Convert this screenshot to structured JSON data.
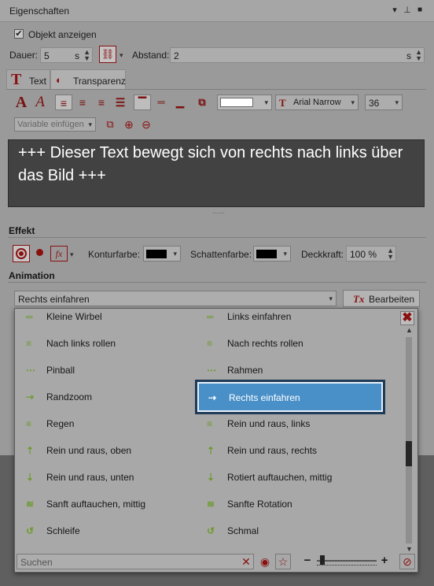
{
  "title": "Eigenschaften",
  "show_object": {
    "label": "Objekt anzeigen",
    "checked": true
  },
  "duration": {
    "label": "Dauer:",
    "value": "5",
    "unit": "s"
  },
  "distance": {
    "label": "Abstand:",
    "value": "2",
    "unit": "s"
  },
  "tabs": [
    {
      "label": "Text",
      "active": true
    },
    {
      "label": "Transparenz",
      "active": false
    }
  ],
  "font": {
    "color": "#ffffff",
    "family": "Arial Narrow",
    "size": "36"
  },
  "variable_placeholder": "Variable einfügen",
  "text_content": "+++ Dieser Text bewegt sich von rechts nach links über das Bild +++",
  "effect": {
    "heading": "Effekt",
    "contour_label": "Konturfarbe:",
    "contour_color": "#000000",
    "shadow_label": "Schattenfarbe:",
    "shadow_color": "#000000",
    "opacity_label": "Deckkraft:",
    "opacity_value": "100 %"
  },
  "animation": {
    "heading": "Animation",
    "selected": "Rechts einfahren",
    "edit_label": "Bearbeiten"
  },
  "list": {
    "left": [
      "Kleine Wirbel",
      "Nach links rollen",
      "Pinball",
      "Randzoom",
      "Regen",
      "Rein und raus, oben",
      "Rein und raus, unten",
      "Sanft auftauchen, mittig",
      "Schleife"
    ],
    "right": [
      "Links einfahren",
      "Nach rechts rollen",
      "Rahmen",
      "Rechts einfahren",
      "Rein und raus, links",
      "Rein und raus, rechts",
      "Rotiert auftauchen, mittig",
      "Sanfte Rotation",
      "Schmal"
    ],
    "selected_index_right": 3,
    "zoom_level": 0.05
  },
  "search_placeholder": "Suchen",
  "colors": {
    "accent_selected": "#4a90c8",
    "icon_green": "#6e9a2e",
    "icon_red": "#8a1010"
  }
}
